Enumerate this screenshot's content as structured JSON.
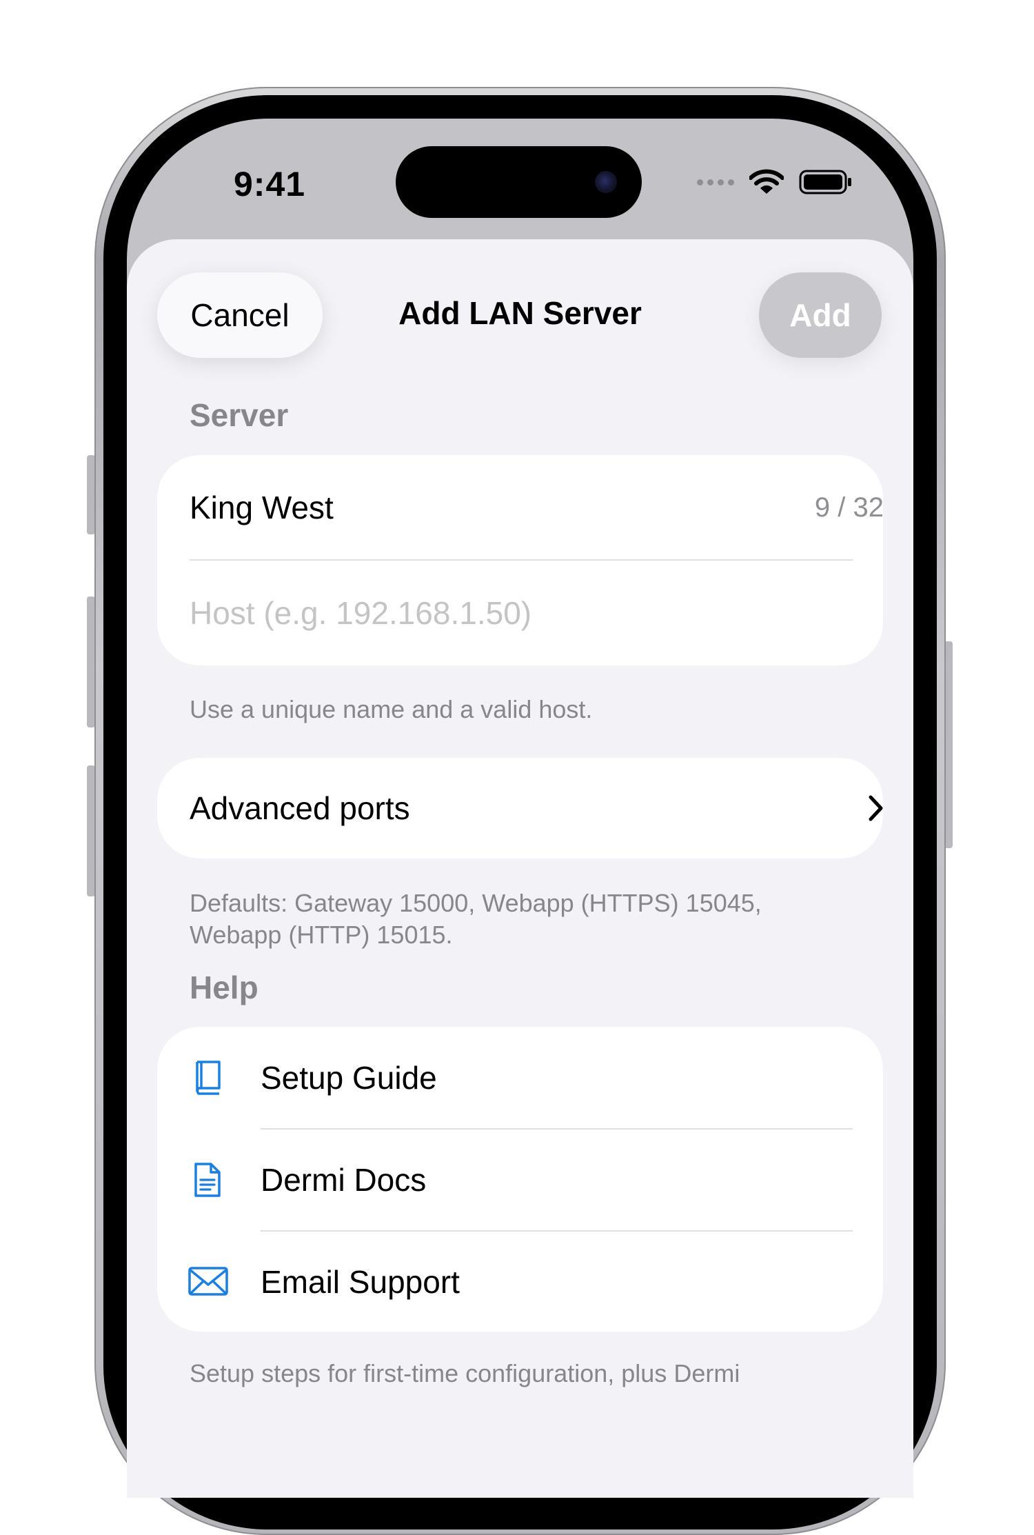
{
  "status_bar": {
    "time": "9:41"
  },
  "navigation": {
    "cancel_label": "Cancel",
    "title": "Add LAN Server",
    "add_label": "Add"
  },
  "server_section": {
    "header": "Server",
    "name_value": "King West",
    "name_counter": "9 / 32",
    "host_placeholder": "Host (e.g. 192.168.1.50)",
    "footnote": "Use a unique name and a valid host."
  },
  "advanced_section": {
    "label": "Advanced ports",
    "footnote": "Defaults: Gateway 15000, Webapp (HTTPS) 15045, Webapp (HTTP) 15015."
  },
  "help_section": {
    "header": "Help",
    "items": [
      {
        "label": "Setup Guide",
        "icon": "book-icon"
      },
      {
        "label": "Dermi Docs",
        "icon": "document-icon"
      },
      {
        "label": "Email Support",
        "icon": "envelope-icon"
      }
    ],
    "footnote": "Setup steps for first-time configuration, plus Dermi"
  },
  "colors": {
    "accent": "#1a7fdf",
    "sheet_background": "#f2f2f7",
    "secondary_text": "#86868b",
    "disabled_button": "#c7c7cc"
  }
}
